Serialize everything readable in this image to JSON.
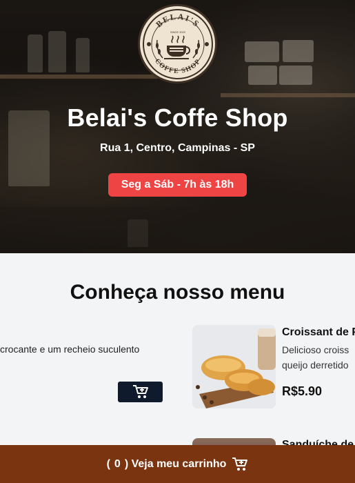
{
  "hero": {
    "logo": {
      "top_text": "BELAI'S",
      "middle_text": "SINCE 2022",
      "bottom_text": "COFFE SHOP"
    },
    "title": "Belai's Coffe Shop",
    "address": "Rua 1, Centro, Campinas - SP",
    "hours": "Seg a Sáb - 7h às 18h"
  },
  "menu": {
    "title": "Conheça nosso menu",
    "items": [
      {
        "description_fragment": "crocante e um recheio suculento",
        "add_icon": "cart-plus-icon"
      },
      {
        "name": "Croissant de P",
        "description_line1": "Delicioso croiss",
        "description_line2": "queijo derretido",
        "price": "R$5.90"
      },
      {
        "name": "Sanduíche de"
      }
    ]
  },
  "cart_bar": {
    "open_paren": "(",
    "count": "0",
    "label": ") Veja meu carrinho",
    "icon": "cart-plus-icon"
  },
  "colors": {
    "hours_badge": "#ef4444",
    "cart_bar": "#7b3410",
    "add_button": "#0f1b2d"
  }
}
